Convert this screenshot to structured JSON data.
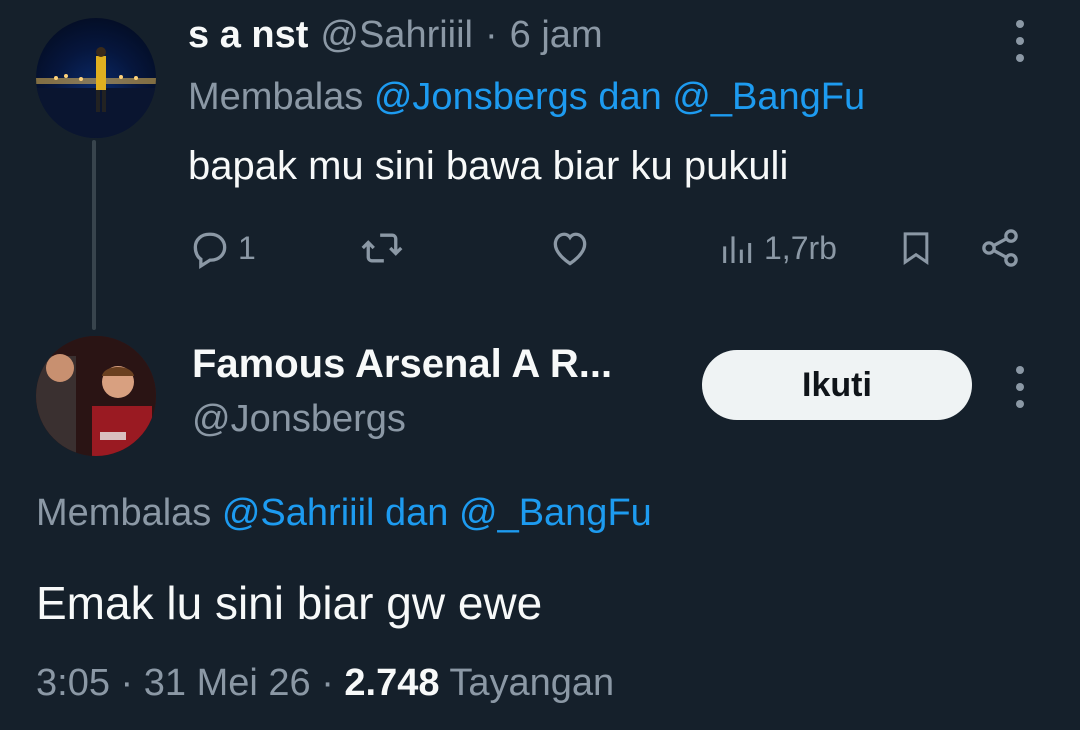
{
  "first_tweet": {
    "display_name": "s a nst",
    "handle": "@Sahriiil",
    "separator": "·",
    "time": "6 jam",
    "replying_prefix": "Membalas",
    "replying_to": "@Jonsbergs dan @_BangFu",
    "text": "bapak mu sini bawa biar ku pukuli",
    "actions": {
      "reply_icon": "reply-icon",
      "reply_count": "1",
      "retweet_icon": "retweet-icon",
      "like_icon": "heart-icon",
      "views_icon": "analytics-icon",
      "views_count": "1,7rb",
      "bookmark_icon": "bookmark-icon",
      "share_icon": "share-icon"
    }
  },
  "second_tweet": {
    "display_name": "Famous Arsenal A R...",
    "handle": "@Jonsbergs",
    "follow_label": "Ikuti",
    "replying_prefix": "Membalas",
    "replying_to": "@Sahriiil dan @_BangFu",
    "text": "Emak lu sini biar gw ewe",
    "time": "3:05",
    "separator": "·",
    "date": "31 Mei 26",
    "separator2": "·",
    "views": "2.748",
    "views_label": "Tayangan"
  },
  "colors": {
    "background": "#15202b",
    "text": "#f7f9f9",
    "muted": "#8b98a5",
    "link": "#1d9bf0"
  }
}
